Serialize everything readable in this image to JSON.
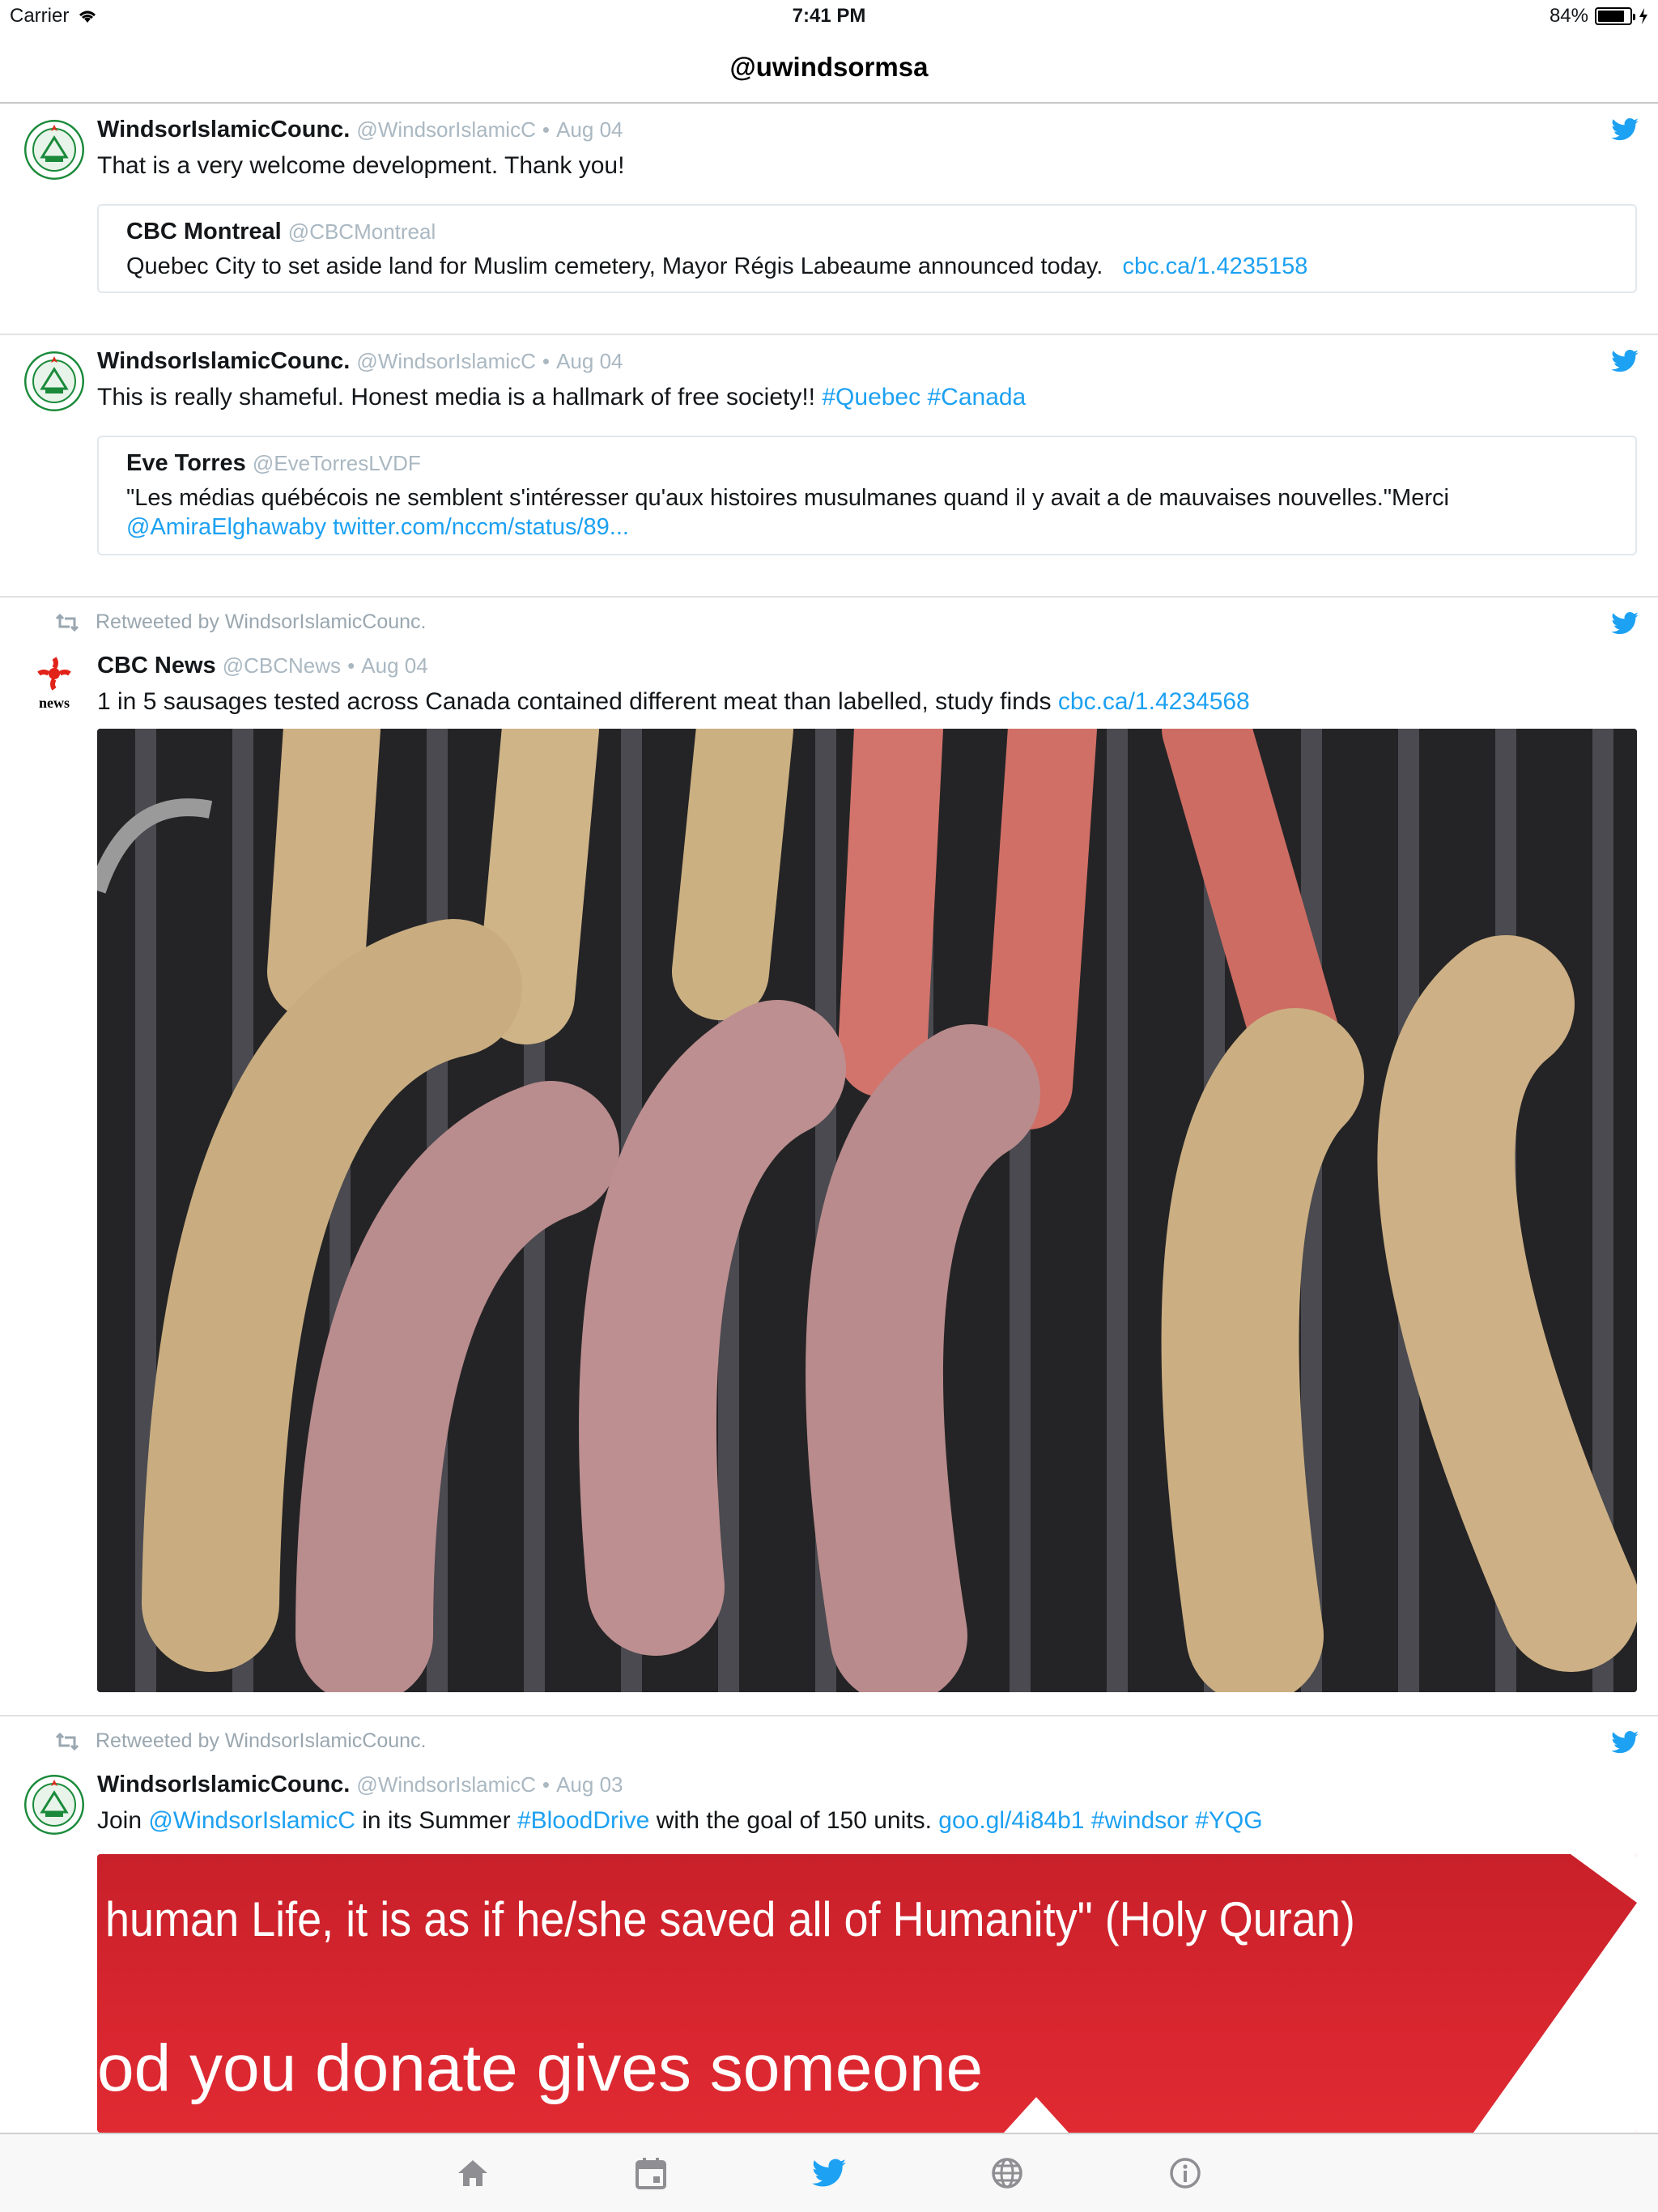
{
  "status": {
    "carrier": "Carrier",
    "time": "7:41 PM",
    "battery": "84%"
  },
  "nav": {
    "title": "@uwindsormsa"
  },
  "tweets": [
    {
      "name": "WindsorIslamicCounc.",
      "handle": "@WindsorIslamicC",
      "date": "Aug 04",
      "text": "That is a very welcome development. Thank you!",
      "quote": {
        "name": "CBC Montreal",
        "handle": "@CBCMontreal",
        "text": "Quebec City to set aside land for Muslim cemetery, Mayor Régis Labeaume announced today.",
        "link": "cbc.ca/1.4235158"
      }
    },
    {
      "name": "WindsorIslamicCounc.",
      "handle": "@WindsorIslamicC",
      "date": "Aug 04",
      "text": "This is really shameful. Honest media is a hallmark of free society!!",
      "hashtags": [
        "#Quebec",
        "#Canada"
      ],
      "quote": {
        "name": "Eve Torres",
        "handle": "@EveTorresLVDF",
        "text": "\"Les médias québécois ne semblent s'intéresser qu'aux histoires musulmanes quand il y avait a de mauvaises nouvelles.\"Merci",
        "mention": "@AmiraElghawaby",
        "link": "twitter.com/nccm/status/89..."
      }
    },
    {
      "retweet_label": "Retweeted by WindsorIslamicCounc.",
      "name": "CBC News",
      "handle": "@CBCNews",
      "date": "Aug 04",
      "avatar_text": "news",
      "text": "1 in 5 sausages tested across Canada contained different meat than labelled, study finds",
      "link": "cbc.ca/1.4234568"
    },
    {
      "retweet_label": "Retweeted by WindsorIslamicCounc.",
      "name": "WindsorIslamicCounc.",
      "handle": "@WindsorIslamicC",
      "date": "Aug 03",
      "text_pre": "Join",
      "mention": "@WindsorIslamicC",
      "text_mid": "in its Summer",
      "hashtag1": "#BloodDrive",
      "text_post": "with the goal of 150 units.",
      "link": "goo.gl/4i84b1",
      "hashtag2": "#windsor",
      "hashtag3": "#YQG",
      "banner_line1": "human Life, it is as if he/she saved all of Humanity\" (Holy Quran)",
      "banner_line2": "od you donate gives someone"
    }
  ],
  "tabs": [
    {
      "icon": "home-icon"
    },
    {
      "icon": "calendar-icon"
    },
    {
      "icon": "twitter-bird-icon"
    },
    {
      "icon": "globe-icon"
    },
    {
      "icon": "info-icon"
    }
  ],
  "colors": {
    "link": "#1da1f2",
    "handle": "#aab8c2",
    "cbc_red": "#e2231a"
  }
}
